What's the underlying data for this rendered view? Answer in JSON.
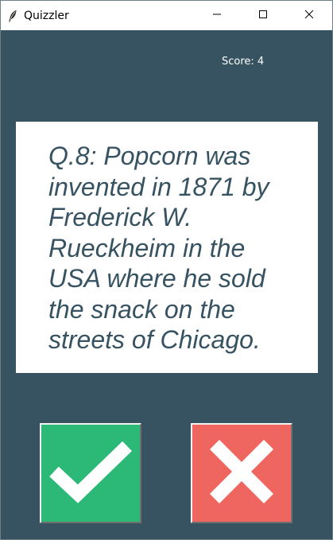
{
  "window": {
    "title": "Quizzler",
    "app_icon": "feather-icon",
    "controls": [
      "minimize-icon",
      "maximize-icon",
      "close-icon"
    ]
  },
  "score": {
    "label": "Score: 4"
  },
  "question": {
    "text": "Q.8: Popcorn was invented in 1871 by Frederick W. Rueckheim in the USA where he sold the snack on the streets of Chicago."
  },
  "answers": {
    "true_icon": "checkmark-icon",
    "false_icon": "cross-icon"
  },
  "colors": {
    "background": "#375362",
    "true_button": "#2cb977",
    "false_button": "#ef6660",
    "card": "#ffffff",
    "question_text": "#375362"
  }
}
